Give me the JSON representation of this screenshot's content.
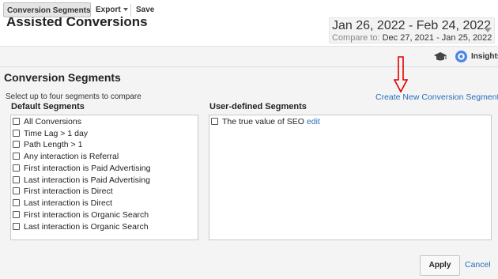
{
  "header": {
    "title": "Assisted Conversions",
    "date_range": "Jan 26, 2022 - Feb 24, 2022",
    "compare_label": "Compare to:",
    "compare_range": "Dec 27, 2021 - Jan 25, 2022"
  },
  "toolbar": {
    "conversion_segments_label": "Conversion Segments",
    "export_label": "Export",
    "save_label": "Save",
    "insights_label": "Insights"
  },
  "panel": {
    "title": "Conversion Segments",
    "instruction": "Select up to four segments to compare",
    "create_link": "Create New Conversion Segment",
    "default_heading": "Default Segments",
    "user_heading": "User-defined Segments",
    "default_segments": [
      "All Conversions",
      "Time Lag > 1 day",
      "Path Length > 1",
      "Any interaction is Referral",
      "First interaction is Paid Advertising",
      "Last interaction is Paid Advertising",
      "First interaction is Direct",
      "Last interaction is Direct",
      "First interaction is Organic Search",
      "Last interaction is Organic Search"
    ],
    "user_segments": [
      {
        "label": "The true value of SEO",
        "edit": "edit"
      }
    ]
  },
  "footer": {
    "apply_label": "Apply",
    "cancel_label": "Cancel"
  },
  "colors": {
    "link": "#2a6ebb",
    "annotation_arrow": "#e00000"
  }
}
